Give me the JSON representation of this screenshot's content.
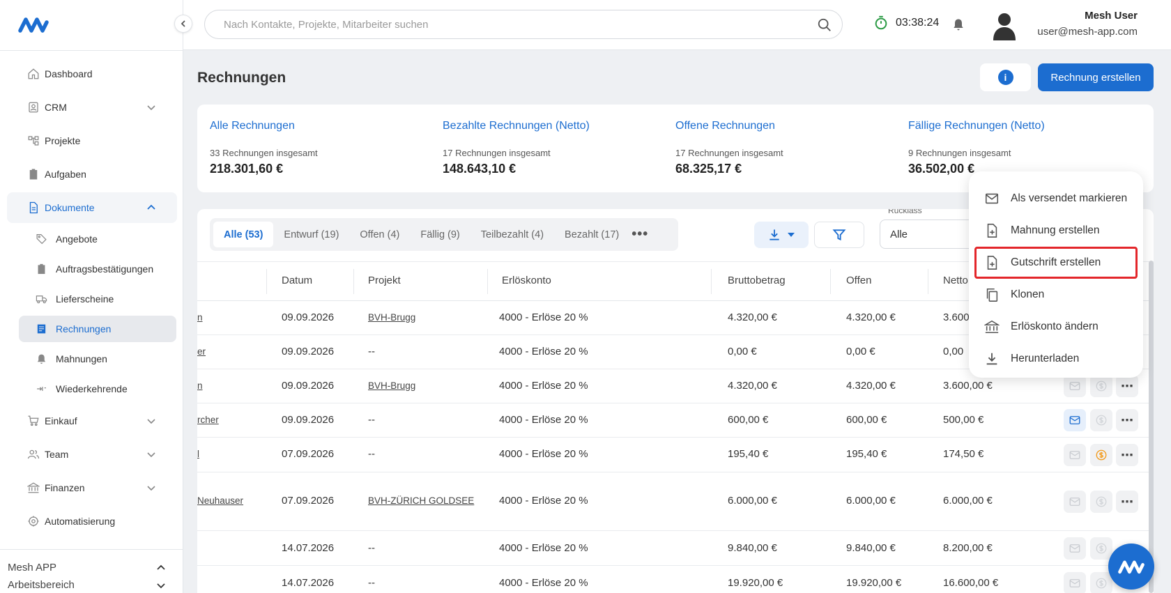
{
  "app": {
    "logo_icon": "mesh-logo-icon"
  },
  "sidebar": {
    "items": [
      {
        "label": "Dashboard",
        "icon": "home-icon"
      },
      {
        "label": "CRM",
        "icon": "contacts-icon"
      },
      {
        "label": "Projekte",
        "icon": "projects-icon"
      },
      {
        "label": "Aufgaben",
        "icon": "clipboard-icon"
      },
      {
        "label": "Dokumente",
        "icon": "document-icon"
      }
    ],
    "sub_items": [
      {
        "label": "Angebote",
        "icon": "tag-icon"
      },
      {
        "label": "Auftragsbestätigungen",
        "icon": "clipboard-icon"
      },
      {
        "label": "Lieferscheine",
        "icon": "truck-icon"
      },
      {
        "label": "Rechnungen",
        "icon": "invoice-icon"
      },
      {
        "label": "Mahnungen",
        "icon": "bell-icon"
      },
      {
        "label": "Wiederkehrende",
        "icon": "recurring-icon"
      }
    ],
    "items_after": [
      {
        "label": "Einkauf",
        "icon": "cart-icon"
      },
      {
        "label": "Team",
        "icon": "team-icon"
      },
      {
        "label": "Finanzen",
        "icon": "bank-icon"
      },
      {
        "label": "Automatisierung",
        "icon": "automation-icon"
      }
    ],
    "workspace": {
      "name": "Mesh APP",
      "label": "Arbeitsbereich"
    }
  },
  "topbar": {
    "search_placeholder": "Nach Kontakte, Projekte, Mitarbeiter suchen",
    "timer": "03:38:24",
    "user_name": "Mesh User",
    "user_email": "user@mesh-app.com"
  },
  "page": {
    "title": "Rechnungen",
    "create_label": "Rechnung erstellen",
    "info_label": "i"
  },
  "stats": [
    {
      "title": "Alle Rechnungen",
      "count": "33 Rechnungen insgesamt",
      "value": "218.301,60 €"
    },
    {
      "title": "Bezahlte Rechnungen (Netto)",
      "count": "17 Rechnungen insgesamt",
      "value": "148.643,10 €"
    },
    {
      "title": "Offene Rechnungen",
      "count": "17 Rechnungen insgesamt",
      "value": "68.325,17 €"
    },
    {
      "title": "Fällige Rechnungen (Netto)",
      "count": "9 Rechnungen insgesamt",
      "value": "36.502,00 €"
    }
  ],
  "tabs": [
    {
      "label": "Alle (53)"
    },
    {
      "label": "Entwurf (19)"
    },
    {
      "label": "Offen (4)"
    },
    {
      "label": "Fällig (9)"
    },
    {
      "label": "Teilbezahlt (4)"
    },
    {
      "label": "Bezahlt (17)"
    }
  ],
  "filter": {
    "label": "Rücklass",
    "value": "Alle"
  },
  "table": {
    "headers": [
      "Datum",
      "Projekt",
      "Erlöskonto",
      "Bruttobetrag",
      "Offen",
      "Netto"
    ],
    "rows": [
      {
        "kunde": "n",
        "datum": "09.09.2026",
        "projekt": "BVH-Brugg",
        "konto": "4000 - Erlöse 20 %",
        "brutto": "4.320,00 €",
        "offen": "4.320,00 €",
        "netto": "3.600"
      },
      {
        "kunde": "er",
        "datum": "09.09.2026",
        "projekt": "--",
        "konto": "4000 - Erlöse 20 %",
        "brutto": "0,00 €",
        "offen": "0,00 €",
        "netto": "0,00"
      },
      {
        "kunde": "n",
        "datum": "09.09.2026",
        "projekt": "BVH-Brugg",
        "konto": "4000 - Erlöse 20 %",
        "brutto": "4.320,00 €",
        "offen": "4.320,00 €",
        "netto": "3.600,00 €"
      },
      {
        "kunde": "rcher",
        "datum": "09.09.2026",
        "projekt": "--",
        "konto": "4000 - Erlöse 20 %",
        "brutto": "600,00 €",
        "offen": "600,00 €",
        "netto": "500,00 €"
      },
      {
        "kunde": "l",
        "datum": "07.09.2026",
        "projekt": "--",
        "konto": "4000 - Erlöse 20 %",
        "brutto": "195,40 €",
        "offen": "195,40 €",
        "netto": "174,50 €"
      },
      {
        "kunde": "Neuhauser",
        "datum": "07.09.2026",
        "projekt": "BVH-ZÜRICH GOLDSEE",
        "konto": "4000 - Erlöse 20 %",
        "brutto": "6.000,00 €",
        "offen": "6.000,00 €",
        "netto": "6.000,00 €"
      },
      {
        "kunde": "",
        "datum": "14.07.2026",
        "projekt": "--",
        "konto": "4000 - Erlöse 20 %",
        "brutto": "9.840,00 €",
        "offen": "9.840,00 €",
        "netto": "8.200,00 €"
      },
      {
        "kunde": "",
        "datum": "14.07.2026",
        "projekt": "--",
        "konto": "4000 - Erlöse 20 %",
        "brutto": "19.920,00 €",
        "offen": "19.920,00 €",
        "netto": "16.600,00 €"
      }
    ]
  },
  "menu": {
    "items": [
      {
        "label": "Als versendet markieren",
        "icon": "mail-icon"
      },
      {
        "label": "Mahnung erstellen",
        "icon": "file-plus-icon"
      },
      {
        "label": "Gutschrift erstellen",
        "icon": "file-plus-icon"
      },
      {
        "label": "Klonen",
        "icon": "copy-icon"
      },
      {
        "label": "Erlöskonto ändern",
        "icon": "bank-icon"
      },
      {
        "label": "Herunterladen",
        "icon": "download-icon"
      }
    ]
  },
  "colors": {
    "accent": "#1c6dd0",
    "highlight": "#e3262a",
    "timer": "#2e9c47",
    "pay_due": "#f29b1d"
  }
}
